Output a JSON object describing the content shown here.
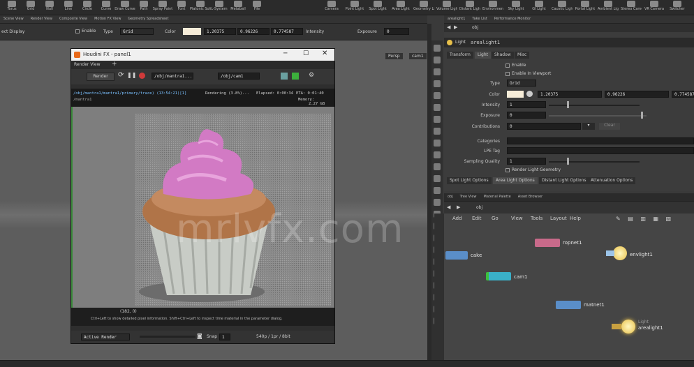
{
  "shelf": {
    "left_tools": [
      "Torus",
      "Grid",
      "Null",
      "Line",
      "Circle",
      "Curve",
      "Draw Curve",
      "Path",
      "Spray Paint",
      "Font",
      "Platonic Solids",
      "L-System",
      "Metaball",
      "File"
    ],
    "right_tools": [
      "Camera",
      "Point Light",
      "Spot Light",
      "Area Light",
      "Geometry Light",
      "Volume Light",
      "Distant Light",
      "Environment Light",
      "Sky Light",
      "GI Light",
      "Caustic Light",
      "Portal Light",
      "Ambient Light",
      "Stereo Camera",
      "VR Camera",
      "Switcher"
    ]
  },
  "tabs_left": [
    "Scene View",
    "Render View",
    "Composite View",
    "Motion FX View",
    "Geometry Spreadsheet"
  ],
  "tabs_right": [
    "arealight1",
    "Take List",
    "Performance Monitor"
  ],
  "toolbar": {
    "display_label": "ect Display",
    "enable_label": "Enable",
    "type_label": "Type",
    "type_value": "Grid",
    "color_label": "Color",
    "color_r": "1.20375",
    "color_g": "0.96226",
    "color_b": "0.774587",
    "intensity_label": "Intensity",
    "exposure_label": "Exposure",
    "exposure_value": "0"
  },
  "viewport": {
    "persp": "Persp",
    "cam": "cam1"
  },
  "render_window": {
    "title": "Houdini FX - panel1",
    "pane_tab": "Render View",
    "render_button": "Render",
    "rop_path": "/obj/mantra1...",
    "cam_path": "/obj/cam1",
    "status_path": "/obj/mantra1/mantra1/primary/trace) (13:54:21)[1]",
    "sub_path": "/mantra1",
    "status_rendering": "Rendering (3.8%)...",
    "status_elapsed": "Elapsed: 0:00:34",
    "status_eta": "ETA: 0:01:40",
    "status_memory_label": "Memory:",
    "status_memory_value": "2.27 GB",
    "coords": "(182, 0)",
    "hint": "Ctrl+Left to show detailed pixel information. Shift+Ctrl+Left to inspect time material in the parameter dialog.",
    "bottom_menu": "Active Render",
    "snap_label": "Snap",
    "snap_value": "1",
    "info": "540p / 1pr / 8bit"
  },
  "params": {
    "header_path": "obj",
    "node_type": "Light",
    "node_name": "arealight1",
    "tabs": [
      "Transform",
      "Light",
      "Shadow",
      "Misc"
    ],
    "enable": "Enable",
    "enable_viewport": "Enable In Viewport",
    "type_label": "Type",
    "type_value": "Grid",
    "color_label": "Color",
    "color_r": "1.20375",
    "color_g": "0.96226",
    "color_b": "0.774587",
    "intensity_label": "Intensity",
    "intensity_value": "1",
    "exposure_label": "Exposure",
    "exposure_value": "0",
    "contributions_label": "Contributions",
    "contributions_value": "0",
    "clear_label": "Clear",
    "categories_label": "Categories",
    "lpe_label": "LPE Tag",
    "sampling_label": "Sampling Quality",
    "sampling_value": "1",
    "render_geo": "Render Light Geometry",
    "sub_tabs": [
      "Spot Light Options",
      "Area Light Options",
      "Distant Light Options",
      "Attenuation Options"
    ]
  },
  "network": {
    "tabs": [
      "obj",
      "Tree View",
      "Material Palette",
      "Asset Browser"
    ],
    "path": "obj",
    "menu": [
      "Add",
      "Edit",
      "Go",
      "View",
      "Tools",
      "Layout",
      "Help"
    ],
    "nodes": [
      {
        "name": "ropnet1",
        "color": "#c86a8a"
      },
      {
        "name": "cake",
        "color": "#5a8ec8"
      },
      {
        "name": "envlight1",
        "color": "#e8c04a"
      },
      {
        "name": "cam1",
        "color": "#3ab0c8"
      },
      {
        "name": "matnet1",
        "color": "#5a8ec8"
      },
      {
        "name": "arealight1",
        "color": "#e8c04a"
      }
    ],
    "arealight_type": "Light"
  },
  "watermark": "mrlvfx.com",
  "colors": {
    "accent": "#e8c04a",
    "render_bg": "#909090"
  }
}
